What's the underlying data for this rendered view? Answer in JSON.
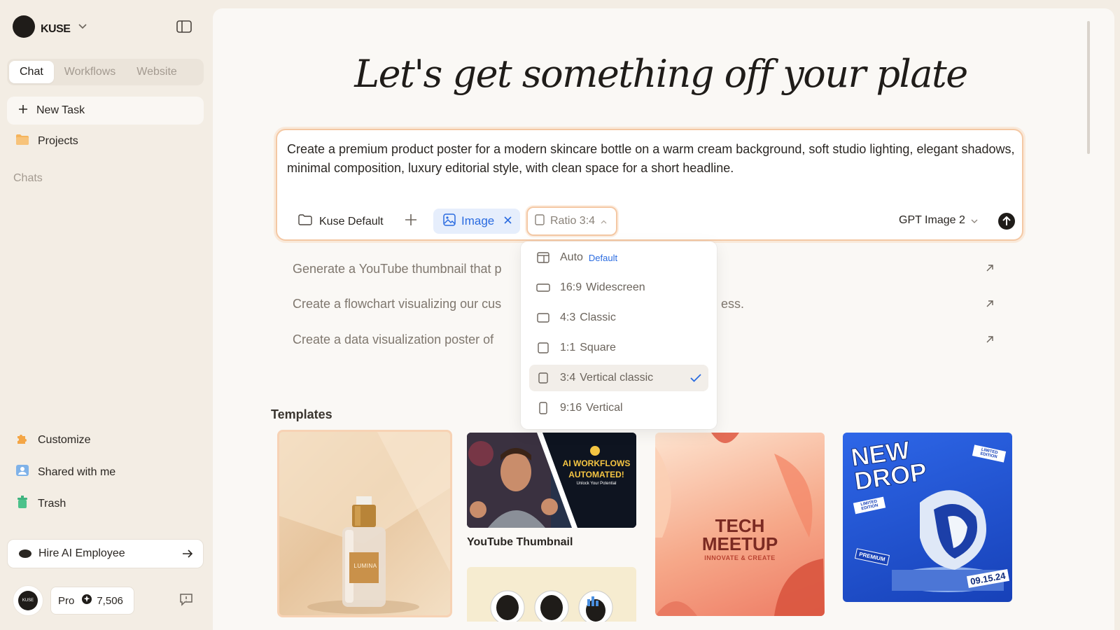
{
  "sidebar": {
    "brand": "KUSE",
    "tabs": [
      "Chat",
      "Workflows",
      "Website"
    ],
    "new_task": "New Task",
    "projects": "Projects",
    "chats_label": "Chats",
    "bottom_items": [
      "Customize",
      "Shared with me",
      "Trash"
    ],
    "hire": "Hire AI Employee",
    "avatar_text": "KUSE",
    "plan": "Pro",
    "credits": "7,506"
  },
  "main": {
    "headline": "Let's get something off your plate",
    "prompt": "Create a premium product poster for a modern skincare bottle on a warm cream background, soft studio lighting, elegant shadows, minimal composition, luxury editorial style, with clean space for a short headline.",
    "workspace": "Kuse Default",
    "mode_chip": "Image",
    "ratio_button": "Ratio 3:4",
    "model": "GPT Image 2",
    "suggestions": [
      "Generate a YouTube thumbnail that p",
      "Create a flowchart visualizing our cus",
      "Create a data visualization poster of"
    ],
    "suggestion_tail": "ess.",
    "templates_label": "Templates",
    "templates": [
      {
        "label": "",
        "brand": "LUMINA"
      },
      {
        "label": "YouTube Thumbnail",
        "line1": "AI WORKFLOWS",
        "line2": "AUTOMATED!",
        "line3": "Unlock Your Potential"
      },
      {
        "label": "",
        "line1": "TECH",
        "line2": "MEETUP",
        "line3": "INNOVATE & CREATE"
      },
      {
        "label": "",
        "line1": "NEW",
        "line2": "DROP",
        "tag1": "LIMITED EDITION",
        "tag2": "PREMIUM",
        "date": "09.15.24"
      }
    ]
  },
  "ratio_menu": [
    {
      "ratio": "Auto",
      "name": "",
      "badge": "Default",
      "selected": false
    },
    {
      "ratio": "16:9",
      "name": "Widescreen",
      "selected": false
    },
    {
      "ratio": "4:3",
      "name": "Classic",
      "selected": false
    },
    {
      "ratio": "1:1",
      "name": "Square",
      "selected": false
    },
    {
      "ratio": "3:4",
      "name": "Vertical classic",
      "selected": true
    },
    {
      "ratio": "9:16",
      "name": "Vertical",
      "selected": false
    }
  ],
  "colors": {
    "accent_blue": "#2a6be0",
    "focus_orange": "#f4c8a4",
    "background": "#f3ede4"
  }
}
